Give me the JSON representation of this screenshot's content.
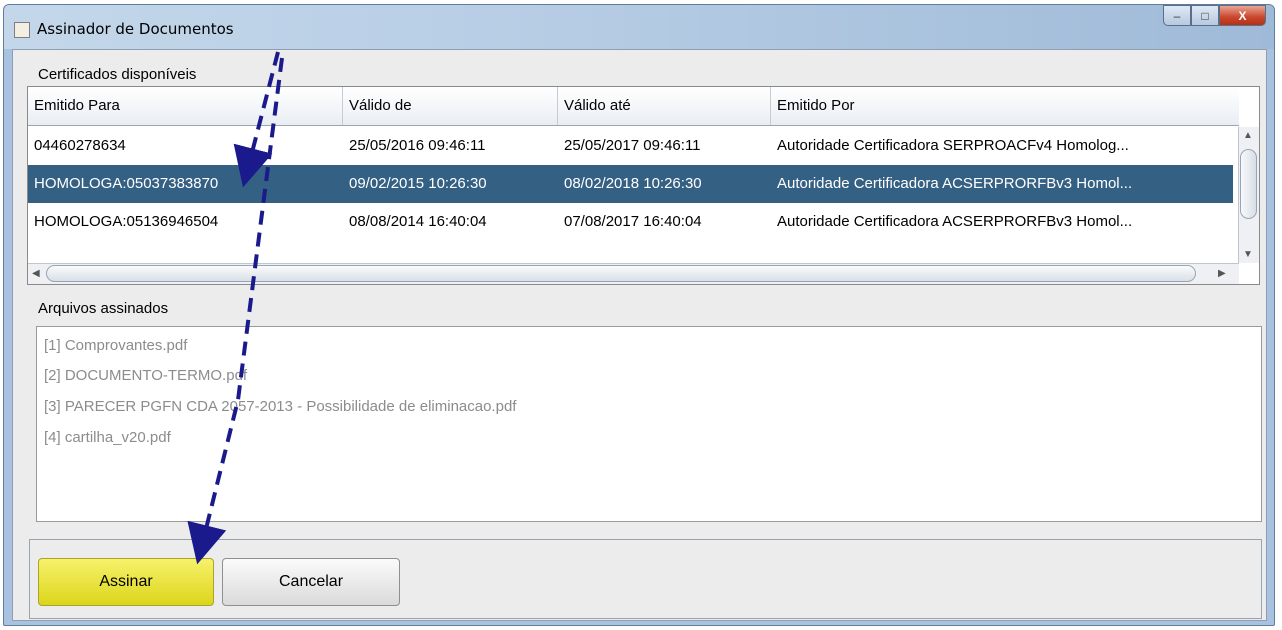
{
  "window": {
    "title": "Assinador de Documentos",
    "buttons": {
      "minimize": "–",
      "maximize": "□",
      "close": "X"
    }
  },
  "certificates": {
    "group_label": "Certificados disponíveis",
    "columns": [
      "Emitido Para",
      "Válido de",
      "Válido até",
      "Emitido Por"
    ],
    "rows": [
      {
        "emitido_para": "04460278634",
        "valido_de": "25/05/2016 09:46:11",
        "valido_ate": "25/05/2017 09:46:11",
        "emitido_por": "Autoridade Certificadora SERPROACFv4 Homolog..."
      },
      {
        "emitido_para": "HOMOLOGA:05037383870",
        "valido_de": "09/02/2015 10:26:30",
        "valido_ate": "08/02/2018 10:26:30",
        "emitido_por": "Autoridade Certificadora ACSERPRORFBv3 Homol...",
        "selected": true
      },
      {
        "emitido_para": "HOMOLOGA:05136946504",
        "valido_de": "08/08/2014 16:40:04",
        "valido_ate": "07/08/2017 16:40:04",
        "emitido_por": "Autoridade Certificadora ACSERPRORFBv3 Homol..."
      }
    ]
  },
  "files": {
    "group_label": "Arquivos assinados",
    "items": [
      "[1] Comprovantes.pdf",
      "[2] DOCUMENTO-TERMO.pdf",
      "[3] PARECER PGFN CDA 2057-2013 - Possibilidade de eliminacao.pdf",
      "[4] cartilha_v20.pdf"
    ]
  },
  "actions": {
    "sign": "Assinar",
    "cancel": "Cancelar"
  },
  "colors": {
    "selection": "#346084",
    "sign_button": "#e9e33a",
    "annotation_arrow": "#1a1a8c"
  }
}
